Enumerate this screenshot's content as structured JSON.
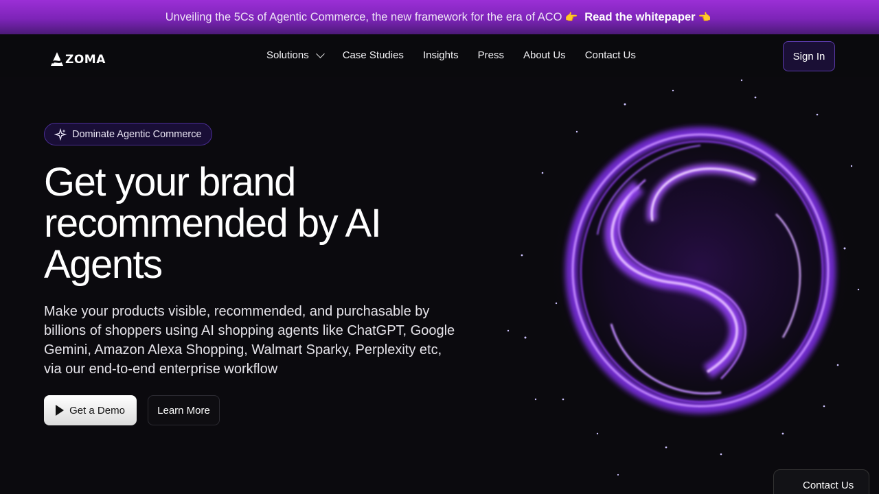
{
  "banner": {
    "text": "Unveiling the 5Cs of Agentic Commerce, the new framework for the era of ACO",
    "link": "Read the whitepaper",
    "hand_left": "👉",
    "hand_right": "👈"
  },
  "nav": {
    "logo": "ZOMA",
    "items": [
      "Solutions",
      "Case Studies",
      "Insights",
      "Press",
      "About Us",
      "Contact Us"
    ],
    "signin": "Sign In"
  },
  "hero": {
    "pill": "Dominate Agentic Commerce",
    "title_lines": [
      "Get your brand",
      "recommended by AI",
      "Agents"
    ],
    "subtitle": "Make your products visible, recommended, and purchasable by billions of shoppers using AI shopping agents like ChatGPT, Google Gemini, Amazon Alexa Shopping, Walmart Sparky, Perplexity etc, via our end-to-end enterprise workflow",
    "demo_button": "Get a Demo",
    "learn_button": "Learn More"
  },
  "floating_contact": "Contact Us",
  "colors": {
    "banner_purple": "#9b2fd6",
    "background": "#0b0a0e",
    "accent_violet": "#8a3cf0"
  },
  "icons": {
    "sparkle": "sparkle-icon",
    "play": "play-icon",
    "chevron": "chevron-down-icon",
    "orb": "swirl-orb-graphic"
  }
}
